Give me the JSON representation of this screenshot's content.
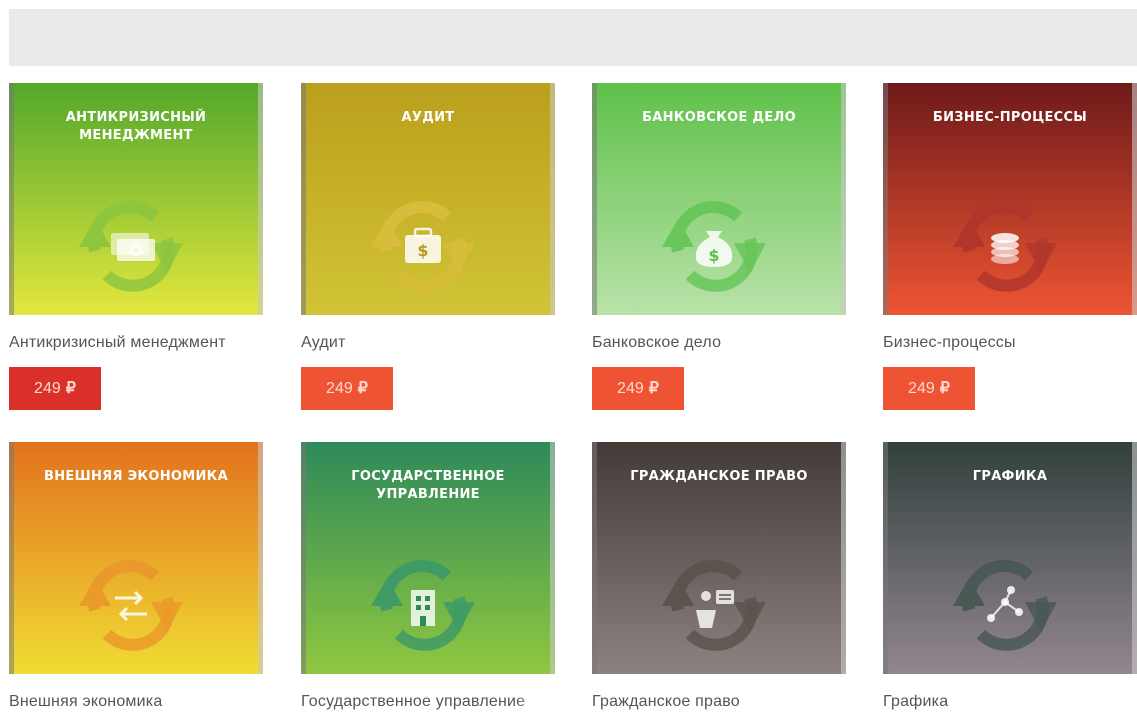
{
  "products": [
    {
      "cover_title": "АНТИКРИЗИСНЫЙ\nМЕНЕДЖМЕНТ",
      "name": "Антикризисный менеджмент",
      "price": "249",
      "currency": "₽",
      "gradient": [
        "#52a82a",
        "#e3e73f"
      ],
      "accent": "#8ec63f",
      "icon": "money-bills-icon",
      "price_color": "#d9302a"
    },
    {
      "cover_title": "АУДИТ",
      "name": "Аудит",
      "price": "249",
      "currency": "₽",
      "gradient": [
        "#bb9f1c",
        "#d1c436"
      ],
      "accent": "#d7bd3b",
      "icon": "briefcase-dollar-icon",
      "price_color": "#ee5333"
    },
    {
      "cover_title": "БАНКОВСКОЕ ДЕЛО",
      "name": "Банковское дело",
      "price": "249",
      "currency": "₽",
      "gradient": [
        "#5fc14a",
        "#b9e2a9"
      ],
      "accent": "#69c65a",
      "icon": "money-bag-icon",
      "price_color": "#ee5333"
    },
    {
      "cover_title": "БИЗНЕС-ПРОЦЕССЫ",
      "name": "Бизнес-процессы",
      "price": "249",
      "currency": "₽",
      "gradient": [
        "#6e1a1a",
        "#ee5533"
      ],
      "accent": "#b0362b",
      "icon": "coins-icon",
      "price_color": "#ee5333"
    },
    {
      "cover_title": "ВНЕШНЯЯ ЭКОНОМИКА",
      "name": "Внешняя экономика",
      "price": "",
      "currency": "",
      "gradient": [
        "#e2721e",
        "#f0dc34"
      ],
      "accent": "#ea9a2a",
      "icon": "exchange-icon",
      "price_color": ""
    },
    {
      "cover_title": "ГОСУДАРСТВЕННОЕ\nУПРАВЛЕНИЕ",
      "name": "Государственное управление",
      "price": "",
      "currency": "",
      "gradient": [
        "#2e8a5a",
        "#8fc73f"
      ],
      "accent": "#3f9a66",
      "icon": "building-icon",
      "price_color": ""
    },
    {
      "cover_title": "ГРАЖДАНСКОЕ ПРАВО",
      "name": "Гражданское право",
      "price": "",
      "currency": "",
      "gradient": [
        "#433b37",
        "#8c8280"
      ],
      "accent": "#5c534f",
      "icon": "speaker-podium-icon",
      "price_color": ""
    },
    {
      "cover_title": "ГРАФИКА",
      "name": "Графика",
      "price": "",
      "currency": "",
      "gradient": [
        "#31403d",
        "#93868f"
      ],
      "accent": "#4a5856",
      "icon": "nodes-graph-icon",
      "price_color": ""
    }
  ]
}
